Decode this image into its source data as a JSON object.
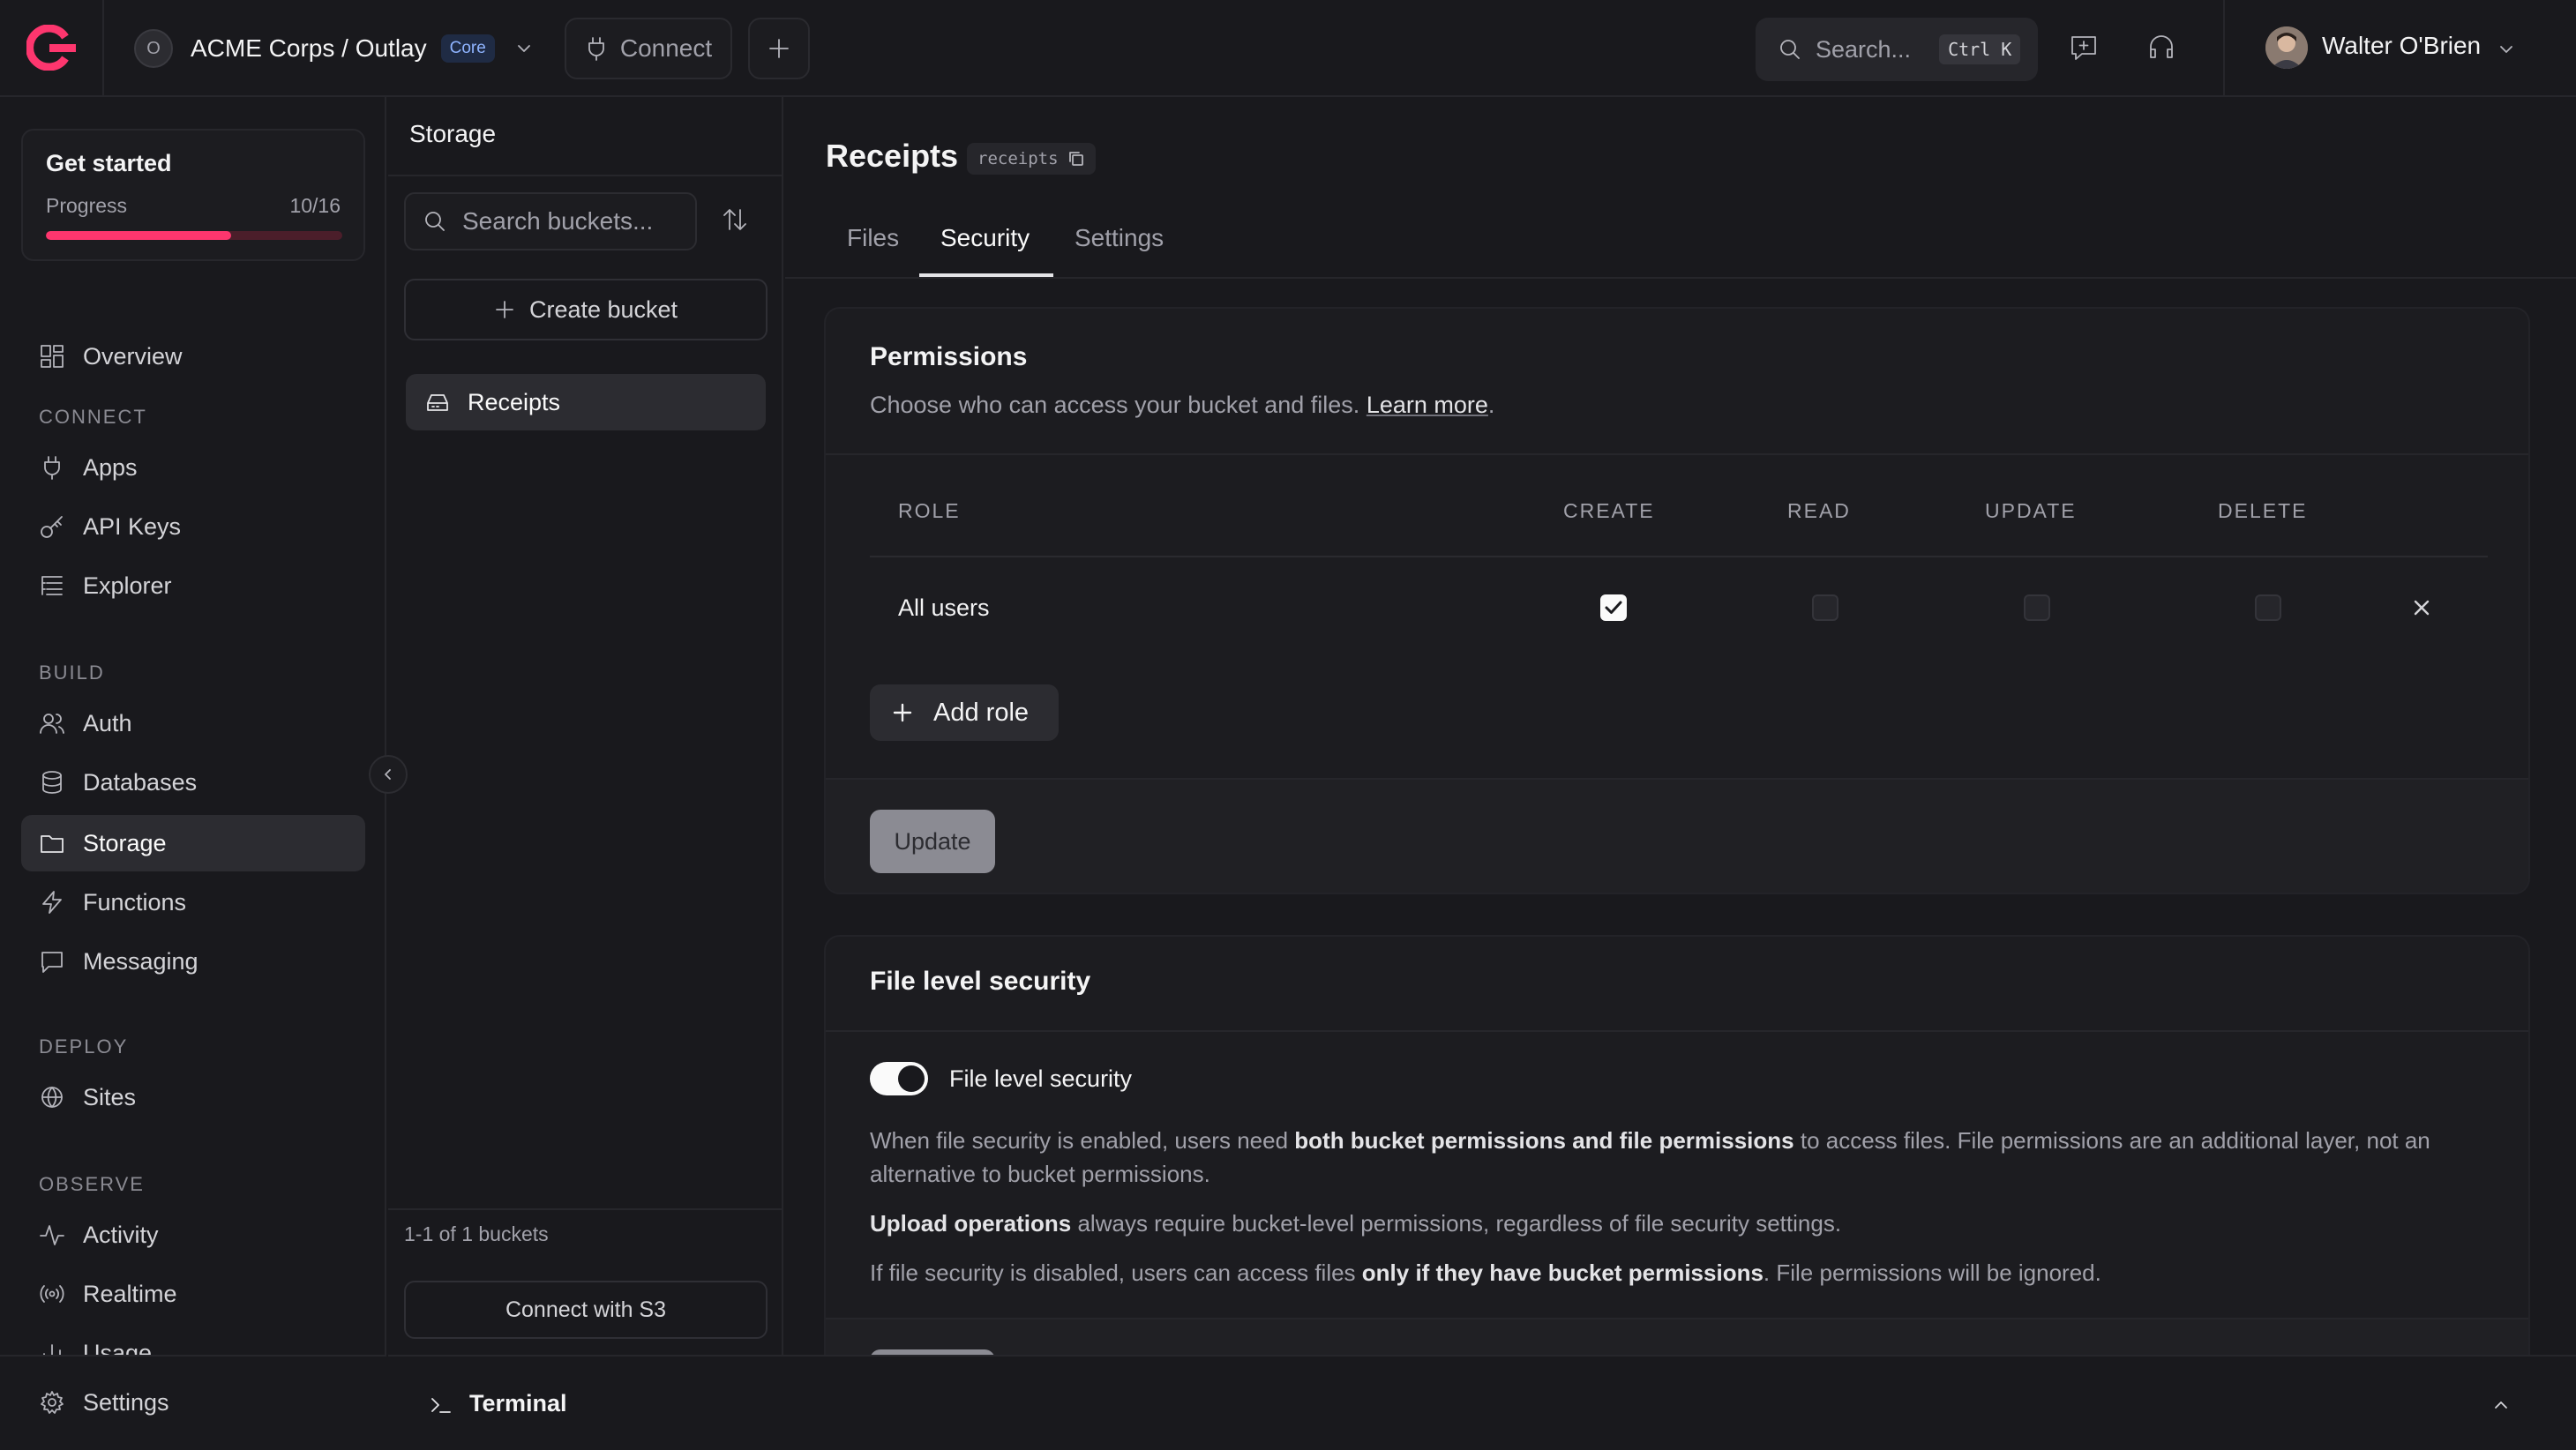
{
  "header": {
    "org_initial": "O",
    "org_name": "ACME Corps / Outlay",
    "tier_badge": "Core",
    "connect_label": "Connect",
    "search_placeholder": "Search...",
    "search_shortcut": "Ctrl K",
    "user_name": "Walter O'Brien",
    "brand_color": "#fd366e"
  },
  "sidebar": {
    "get_started": {
      "title": "Get started",
      "progress_label": "Progress",
      "progress_value": "10/16",
      "progress_fraction": 0.625
    },
    "overview": "Overview",
    "sections": {
      "connect": "CONNECT",
      "build": "BUILD",
      "deploy": "DEPLOY",
      "observe": "OBSERVE"
    },
    "items": {
      "apps": "Apps",
      "api_keys": "API Keys",
      "explorer": "Explorer",
      "auth": "Auth",
      "databases": "Databases",
      "storage": "Storage",
      "functions": "Functions",
      "messaging": "Messaging",
      "sites": "Sites",
      "activity": "Activity",
      "realtime": "Realtime",
      "usage": "Usage",
      "settings": "Settings"
    },
    "active": "storage"
  },
  "buckets": {
    "title": "Storage",
    "search_placeholder": "Search buckets...",
    "create_label": "Create bucket",
    "items": [
      "Receipts"
    ],
    "count_text": "1-1 of 1 buckets",
    "s3_label": "Connect with S3"
  },
  "terminal": {
    "label": "Terminal"
  },
  "main": {
    "title": "Receipts",
    "slug": "receipts",
    "tabs": [
      "Files",
      "Security",
      "Settings"
    ],
    "active_tab": "Security",
    "permissions": {
      "title": "Permissions",
      "description": "Choose who can access your bucket and files.",
      "learn_more": "Learn more",
      "columns": [
        "ROLE",
        "CREATE",
        "READ",
        "UPDATE",
        "DELETE"
      ],
      "rows": [
        {
          "role": "All users",
          "create": true,
          "read": false,
          "update": false,
          "delete": false
        }
      ],
      "add_role_label": "Add role",
      "update_label": "Update"
    },
    "file_security": {
      "title": "File level security",
      "toggle_label": "File level security",
      "enabled": true,
      "p1_a": "When file security is enabled, users need ",
      "p1_b": "both bucket permissions and file permissions",
      "p1_c": " to access files. File permissions are an additional layer, not an alternative to bucket permissions.",
      "p2_a": "Upload operations",
      "p2_b": " always require bucket-level permissions, regardless of file security settings.",
      "p3_a": "If file security is disabled, users can access files ",
      "p3_b": "only if they have bucket permissions",
      "p3_c": ". File permissions will be ignored."
    }
  }
}
